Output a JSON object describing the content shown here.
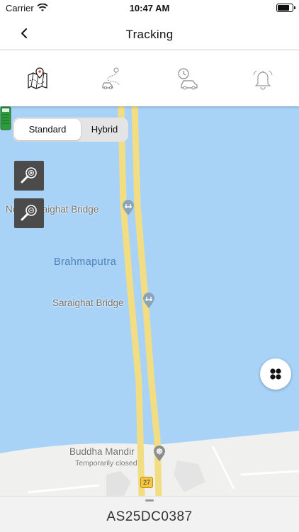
{
  "status_bar": {
    "carrier": "Carrier",
    "time": "10:47 AM",
    "battery_level": 0.9
  },
  "nav": {
    "title": "Tracking"
  },
  "tabs": [
    "map-location-icon",
    "route-icon",
    "history-clock-car-icon",
    "alert-bell-icon"
  ],
  "map": {
    "map_type_options": [
      "Standard",
      "Hybrid"
    ],
    "selected_map_type": "Standard",
    "labels": {
      "bridge_1": "New Saraighat Bridge",
      "river": "Brahmaputra",
      "bridge_2": "Saraighat Bridge",
      "place": "Buddha Mandir",
      "place_status": "Temporarily closed",
      "road_number": "27"
    },
    "colors": {
      "water": "#a8d3f7",
      "road": "#f8e48a",
      "land": "#f0f0ee",
      "vehicle": "#2e9c3a"
    }
  },
  "sheet": {
    "vehicle_number": "AS25DC0387"
  }
}
